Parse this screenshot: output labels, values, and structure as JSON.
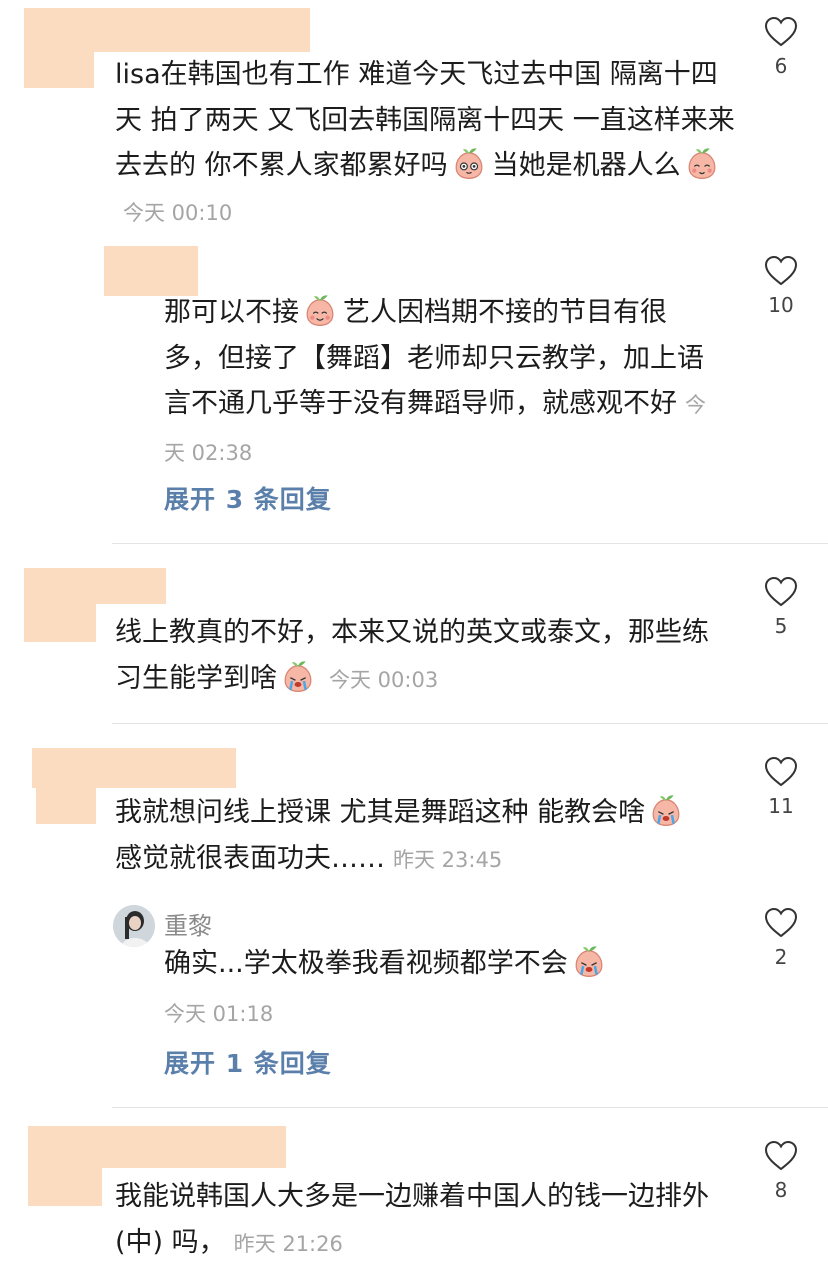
{
  "comments": [
    {
      "parts": [
        "lisa在韩国也有工作 难道今天飞过去中国 隔离十四天 拍了两天 又飞回去韩国隔离十四天 一直这样来来去去的 你不累人家都累好吗",
        "当她是机器人么"
      ],
      "time": "今天 00:10",
      "likes": "6",
      "emojis": [
        "peach-big-eyes-emoji",
        "peach-shy-emoji"
      ]
    },
    {
      "parts": [
        "那可以不接",
        "艺人因档期不接的节目有很多，但接了【舞蹈】老师却只云教学，加上语言不通几乎等于没有舞蹈导师，就感观不好"
      ],
      "time": "今天 02:38",
      "likes": "10",
      "expand_label": "展开 3 条回复",
      "emojis": [
        "peach-smile-emoji"
      ]
    },
    {
      "parts": [
        "线上教真的不好，本来又说的英文或泰文，那些练习生能学到啥"
      ],
      "time": "今天 00:03",
      "likes": "5",
      "emojis": [
        "peach-crying-emoji"
      ]
    },
    {
      "parts": [
        "我就想问线上授课 尤其是舞蹈这种 能教会啥",
        "感觉就很表面功夫……"
      ],
      "time": "昨天 23:45",
      "likes": "11",
      "emojis": [
        "peach-crying-emoji"
      ]
    },
    {
      "username": "重黎",
      "parts": [
        "确实...学太极拳我看视频都学不会"
      ],
      "time": "今天 01:18",
      "likes": "2",
      "expand_label": "展开 1 条回复",
      "emojis": [
        "peach-crying-emoji"
      ]
    },
    {
      "parts": [
        "我能说韩国人大多是一边赚着中国人的钱一边排外 (中) 吗，"
      ],
      "time": "昨天 21:26",
      "likes": "8"
    }
  ],
  "colors": {
    "redaction": "#fcdcc0",
    "link": "#5b7fab",
    "timestamp": "#a5a5a5"
  }
}
